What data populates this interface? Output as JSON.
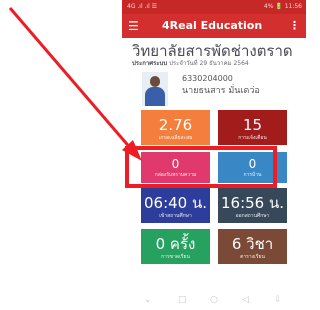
{
  "status_bar": {
    "left": "4G .ıl .ıl ☰",
    "right": "4% 🔋 11:56"
  },
  "app_bar": {
    "menu_icon": "hamburger-menu-icon",
    "title": "4Real Education",
    "more_icon": "more-vertical-icon"
  },
  "school_name": "วิทยาลัยสารพัดช่างตราด",
  "announcement": {
    "label": "ประกาศระบบ",
    "text": "ประจำวันที่ 29 ธันวาคม 2564"
  },
  "student": {
    "id": "6330204000",
    "name": "นายธนสาร มั่นเดว่อ"
  },
  "tiles": [
    {
      "value": "2.76",
      "caption": "เกรดเฉลี่ยสะสม",
      "color": "#f47f3c"
    },
    {
      "value": "15",
      "caption": "การแจ้งเตือน",
      "color": "#a31c1c"
    },
    {
      "value": "0",
      "caption": "กล่องรับทราบความ",
      "color": "#e0396e"
    },
    {
      "value": "0",
      "caption": "การบ้าน",
      "color": "#3a87c6"
    },
    {
      "value": "06:40 น.",
      "caption": "เข้าสถานศึกษา",
      "color": "#2d3d9b"
    },
    {
      "value": "16:56 น.",
      "caption": "ออกสถานศึกษา",
      "color": "#37485a"
    },
    {
      "value": "0 ครั้ง",
      "caption": "การขาดเรียน",
      "color": "#26a160"
    },
    {
      "value": "6 วิชา",
      "caption": "ตารางเรียน",
      "color": "#7a4a36"
    }
  ],
  "nav_bar": [
    "⌄",
    "□",
    "○",
    "◁",
    "⇩"
  ],
  "annotation": {
    "arrow_color": "#ec1d24",
    "box_color": "#ec1d24"
  }
}
